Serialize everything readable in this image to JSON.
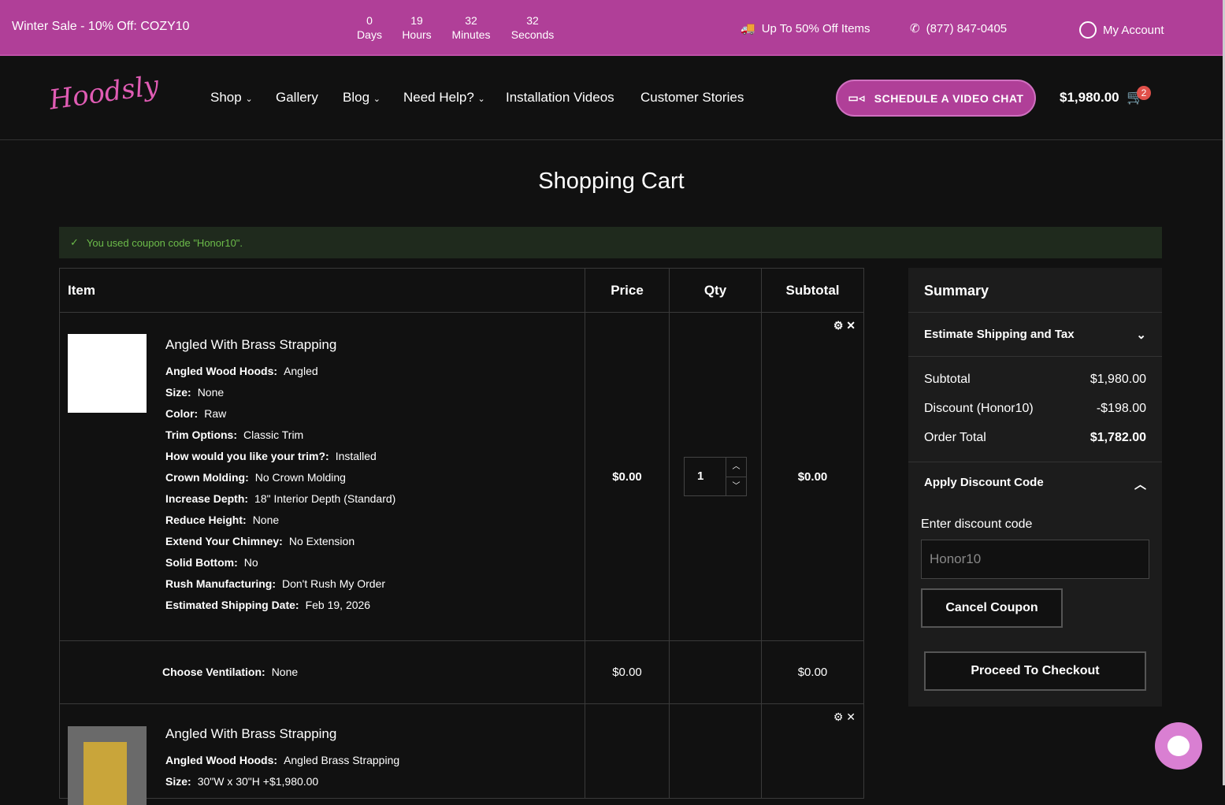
{
  "topbar": {
    "sale": "Winter Sale - 10% Off: COZY10",
    "countdown": [
      {
        "v": "0",
        "l": "Days"
      },
      {
        "v": "19",
        "l": "Hours"
      },
      {
        "v": "32",
        "l": "Minutes"
      },
      {
        "v": "32",
        "l": "Seconds"
      }
    ],
    "promo": "Up To 50% Off Items",
    "phone": "(877) 847-0405",
    "account": "My Account"
  },
  "nav": {
    "logo": "Hoodsly",
    "items": [
      "Shop",
      "Gallery",
      "Blog",
      "Need Help?",
      "Installation Videos",
      "Customer Stories"
    ],
    "video_chat": "SCHEDULE A VIDEO CHAT",
    "cart_total": "$1,980.00",
    "cart_count": "2"
  },
  "page_title": "Shopping Cart",
  "message": "You used coupon code \"Honor10\".",
  "table": {
    "headers": [
      "Item",
      "Price",
      "Qty",
      "Subtotal"
    ],
    "item1": {
      "name": "Angled With Brass Strapping",
      "options": [
        [
          "Angled Wood Hoods:",
          "Angled"
        ],
        [
          "Size:",
          "None"
        ],
        [
          "Color:",
          "Raw"
        ],
        [
          "Trim Options:",
          "Classic Trim"
        ],
        [
          "How would you like your trim?:",
          "Installed"
        ],
        [
          "Crown Molding:",
          "No Crown Molding"
        ],
        [
          "Increase Depth:",
          "18\" Interior Depth (Standard)"
        ],
        [
          "Reduce Height:",
          "None"
        ],
        [
          "Extend Your Chimney:",
          "No Extension"
        ],
        [
          "Solid Bottom:",
          "No"
        ],
        [
          "Rush Manufacturing:",
          "Don't Rush My Order"
        ],
        [
          "Estimated Shipping Date:",
          "Feb 19, 2026"
        ]
      ],
      "price": "$0.00",
      "qty": "1",
      "subtotal": "$0.00"
    },
    "vent": {
      "label": "Choose Ventilation:",
      "value": "None",
      "price": "$0.00",
      "subtotal": "$0.00"
    },
    "item2": {
      "name": "Angled With Brass Strapping",
      "options": [
        [
          "Angled Wood Hoods:",
          "Angled Brass Strapping"
        ],
        [
          "Size:",
          "30\"W x 30\"H +$1,980.00"
        ]
      ]
    }
  },
  "summary": {
    "title": "Summary",
    "shipping": "Estimate Shipping and Tax",
    "rows": [
      [
        "Subtotal",
        "$1,980.00"
      ],
      [
        "Discount (Honor10)",
        "-$198.00"
      ],
      [
        "Order Total",
        "$1,782.00"
      ]
    ],
    "discount_title": "Apply Discount Code",
    "discount_label": "Enter discount code",
    "discount_value": "Honor10",
    "cancel": "Cancel Coupon",
    "checkout": "Proceed To Checkout"
  }
}
